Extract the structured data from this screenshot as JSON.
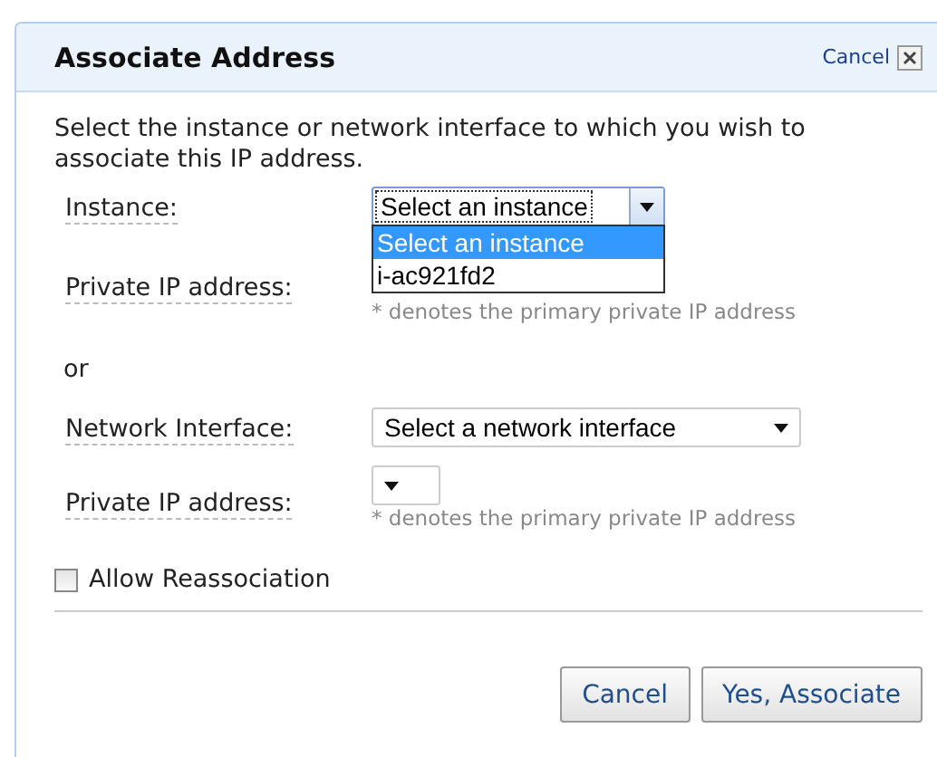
{
  "dialog": {
    "title": "Associate Address",
    "close_link": "Cancel",
    "intro": "Select the instance or network interface to which you wish to associate this IP address.",
    "instance": {
      "label": "Instance:",
      "value": "Select an instance",
      "expanded": true,
      "options": [
        {
          "label": "Select an instance",
          "selected": true
        },
        {
          "label": "i-ac921fd2",
          "selected": false
        }
      ]
    },
    "instance_private_ip": {
      "label": "Private IP address:",
      "hint": "* denotes the primary private IP address"
    },
    "or_text": "or",
    "network_interface": {
      "label": "Network Interface:",
      "value": "Select a network interface"
    },
    "interface_private_ip": {
      "label": "Private IP address:",
      "hint": "* denotes the primary private IP address"
    },
    "allow_reassociation": {
      "label": "Allow Reassociation",
      "checked": false
    },
    "buttons": [
      {
        "label": "Cancel"
      },
      {
        "label": "Yes, Associate"
      }
    ]
  }
}
